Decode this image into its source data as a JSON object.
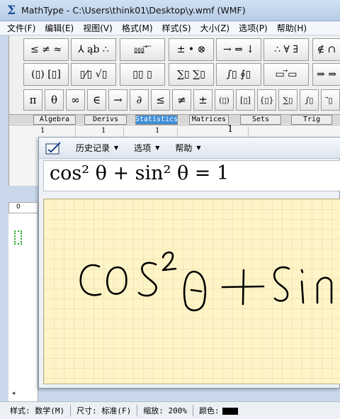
{
  "window": {
    "title": "MathType - C:\\Users\\think01\\Desktop\\y.wmf (WMF)"
  },
  "menubar": [
    "文件(F)",
    "编辑(E)",
    "视图(V)",
    "格式(M)",
    "样式(S)",
    "大小(Z)",
    "选项(P)",
    "帮助(H)"
  ],
  "palette": {
    "row1": [
      "≤ ≠ ≈",
      "⅄ ąb ∴",
      "⅏ ⃗ ⃛",
      "± • ⊗",
      "→ ⇔ ↓",
      "∴ ∀ ∃",
      "∉ ∩"
    ],
    "row2": [
      "(▯) [▯]",
      "▯⁄▯ √▯",
      "▯▯ ▯",
      "∑▯ ∑▯",
      "∫▯ ∮▯",
      "▭ ⃗▭",
      "⇒ ⇒"
    ],
    "symbols": [
      "π",
      "θ",
      "∞",
      "∈",
      "→",
      "∂",
      "≤",
      "≠",
      "±",
      "(▯)",
      "[▯]",
      "{▯}",
      "∑▯",
      "∫▯",
      "⃗▯"
    ],
    "tabs": [
      "Algebra",
      "Derivs",
      "Statistics",
      "Matrices",
      "Sets",
      "Trig"
    ],
    "active_tab": "Statistics",
    "template_numbers": [
      "1",
      "1",
      "1",
      "1"
    ],
    "ruler_label": "0"
  },
  "math_input": {
    "menus": [
      "历史记录",
      "选项",
      "帮助"
    ],
    "preview": "cos² θ + sin² θ = 1",
    "handwriting": "cos²θ+sin"
  },
  "statusbar": {
    "style": "样式: 数学(M)",
    "size": "尺寸: 标准(F)",
    "zoom": "缩放: 200%",
    "color_label": "颜色:",
    "color_value": "#000000"
  }
}
